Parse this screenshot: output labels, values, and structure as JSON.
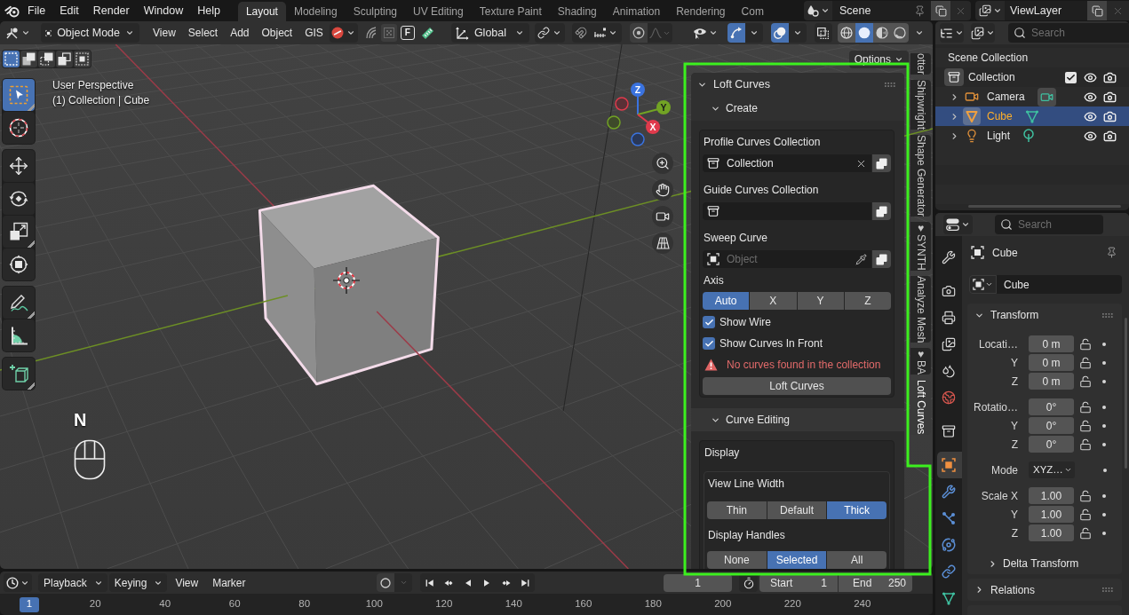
{
  "top_bar": {
    "menus": [
      "File",
      "Edit",
      "Render",
      "Window",
      "Help"
    ],
    "workspaces": [
      {
        "label": "Layout",
        "selected": true
      },
      {
        "label": "Modeling",
        "selected": false
      },
      {
        "label": "Sculpting",
        "selected": false
      },
      {
        "label": "UV Editing",
        "selected": false
      },
      {
        "label": "Texture Paint",
        "selected": false
      },
      {
        "label": "Shading",
        "selected": false
      },
      {
        "label": "Animation",
        "selected": false
      },
      {
        "label": "Rendering",
        "selected": false
      },
      {
        "label": "Com",
        "selected": false
      }
    ],
    "scene": "Scene",
    "view_layer": "ViewLayer"
  },
  "viewport_header": {
    "mode": "Object Mode",
    "menus": [
      "View",
      "Select",
      "Add",
      "Object",
      "GIS"
    ],
    "toggle_key": "F",
    "orientation": "Global",
    "gizmos_on": true,
    "overlays_on": true,
    "shading_modes": [
      {
        "kind": "wireframe",
        "selected": false
      },
      {
        "kind": "solid",
        "selected": true
      },
      {
        "kind": "material",
        "selected": false
      },
      {
        "kind": "rendered",
        "selected": false
      }
    ]
  },
  "viewport": {
    "selection_modes": [
      {
        "kind": "new",
        "selected": true
      },
      {
        "kind": "extend",
        "selected": false
      },
      {
        "kind": "subtract",
        "selected": false
      },
      {
        "kind": "invert",
        "selected": false
      },
      {
        "kind": "intersect",
        "selected": false
      }
    ],
    "tool_groups": [
      {
        "tools": [
          {
            "kind": "select_box",
            "selected": true,
            "submenu": true
          },
          {
            "kind": "cursor",
            "selected": false,
            "submenu": false
          }
        ]
      },
      {
        "tools": [
          {
            "kind": "move",
            "selected": false,
            "submenu": false
          },
          {
            "kind": "rotate",
            "selected": false,
            "submenu": false
          },
          {
            "kind": "scale",
            "selected": false,
            "submenu": true
          },
          {
            "kind": "transform",
            "selected": false,
            "submenu": false
          }
        ]
      },
      {
        "tools": [
          {
            "kind": "annotate",
            "selected": false,
            "submenu": true
          },
          {
            "kind": "measure",
            "selected": false,
            "submenu": false
          }
        ]
      },
      {
        "tools": [
          {
            "kind": "add_cube",
            "selected": false,
            "submenu": true
          }
        ]
      }
    ],
    "view_name": "User Perspective",
    "context": "(1) Collection | Cube",
    "gizmo_labels": {
      "x": "X",
      "y": "Y",
      "z": "Z"
    },
    "options": "Options",
    "key_pressed": "N"
  },
  "sidebar": {
    "panel": {
      "title": "Loft Curves",
      "expanded": true
    },
    "create": {
      "title": "Create",
      "expanded": true,
      "fields": [
        {
          "label": "Profile Curves Collection",
          "kind": "collection",
          "value": "Collection"
        },
        {
          "label": "Guide Curves Collection",
          "kind": "collection"
        },
        {
          "label": "Sweep Curve",
          "kind": "object",
          "placeholder": "Object"
        }
      ],
      "axis_label": "Axis",
      "axis_options": [
        {
          "label": "Auto",
          "selected": true
        },
        {
          "label": "X",
          "selected": false
        },
        {
          "label": "Y",
          "selected": false
        },
        {
          "label": "Z",
          "selected": false
        }
      ],
      "checkboxes": [
        {
          "label": "Show Wire",
          "checked": true
        },
        {
          "label": "Show Curves In Front",
          "checked": true
        }
      ],
      "warning": "No curves found in the collection",
      "action": "Loft Curves"
    },
    "curve_editing": {
      "title": "Curve Editing",
      "expanded": true,
      "box_title": "Display",
      "groups": [
        {
          "label": "View Line Width",
          "options": [
            {
              "label": "Thin",
              "selected": false
            },
            {
              "label": "Default",
              "selected": false
            },
            {
              "label": "Thick",
              "selected": true
            }
          ]
        },
        {
          "label": "Display Handles",
          "options": [
            {
              "label": "None",
              "selected": false
            },
            {
              "label": "Selected",
              "selected": true
            },
            {
              "label": "All",
              "selected": false
            }
          ]
        }
      ]
    },
    "tabs": [
      {
        "label": "otter",
        "selected": false
      },
      {
        "label": "Shipwright",
        "selected": false
      },
      {
        "label": "Shape Generator",
        "selected": false
      },
      {
        "label": "♥SYNTH",
        "selected": false
      },
      {
        "label": "Analyze Mesh",
        "selected": false
      },
      {
        "label": "♥BA",
        "selected": false
      },
      {
        "label": "Loft Curves",
        "selected": true
      }
    ]
  },
  "outliner": {
    "search_placeholder": "Search",
    "root": "Scene Collection",
    "items": [
      {
        "label": "Collection",
        "active": true,
        "checked": true,
        "children": [
          {
            "label": "Camera",
            "kind": "camera",
            "selected": false,
            "expanded": false,
            "data_active": true
          },
          {
            "label": "Cube",
            "kind": "mesh",
            "selected": true,
            "expanded": false,
            "data_active": false
          },
          {
            "label": "Light",
            "kind": "light",
            "selected": false,
            "expanded": false,
            "data_active": false
          }
        ]
      }
    ]
  },
  "properties": {
    "search_placeholder": "Search",
    "tab_groups": [
      {
        "tabs": [
          {
            "kind": "tool",
            "selected": false
          }
        ]
      },
      {
        "tabs": [
          {
            "kind": "render",
            "selected": false
          },
          {
            "kind": "output",
            "selected": false
          },
          {
            "kind": "view_layer",
            "selected": false
          },
          {
            "kind": "scene",
            "selected": false
          },
          {
            "kind": "world",
            "selected": false
          }
        ]
      },
      {
        "tabs": [
          {
            "kind": "collection",
            "selected": false
          }
        ]
      },
      {
        "tabs": [
          {
            "kind": "object",
            "selected": true
          },
          {
            "kind": "modifiers",
            "selected": false
          },
          {
            "kind": "particles",
            "selected": false
          },
          {
            "kind": "physics",
            "selected": false
          },
          {
            "kind": "constraints",
            "selected": false
          },
          {
            "kind": "data",
            "selected": false
          }
        ]
      }
    ],
    "object": "Cube",
    "name": "Cube",
    "panels": [
      {
        "title": "Transform",
        "expanded": true,
        "groups": [
          {
            "rows": [
              {
                "label": "Locati…",
                "value": "0 m",
                "kind": "number",
                "locked": false
              },
              {
                "label": "Y",
                "value": "0 m",
                "kind": "number",
                "locked": false
              },
              {
                "label": "Z",
                "value": "0 m",
                "kind": "number",
                "locked": false
              }
            ]
          },
          {
            "rows": [
              {
                "label": "Rotatio…",
                "value": "0°",
                "kind": "number",
                "locked": false
              },
              {
                "label": "Y",
                "value": "0°",
                "kind": "number",
                "locked": false
              },
              {
                "label": "Z",
                "value": "0°",
                "kind": "number",
                "locked": false
              }
            ]
          },
          {
            "rows": [
              {
                "label": "Mode",
                "value": "XYZ…",
                "kind": "dropdown"
              }
            ]
          },
          {
            "rows": [
              {
                "label": "Scale X",
                "value": "1.00",
                "kind": "number",
                "locked": false
              },
              {
                "label": "Y",
                "value": "1.00",
                "kind": "number",
                "locked": false
              },
              {
                "label": "Z",
                "value": "1.00",
                "kind": "number",
                "locked": false
              }
            ]
          }
        ],
        "subpanels": [
          {
            "title": "Delta Transform",
            "expanded": false
          }
        ]
      },
      {
        "title": "Relations",
        "expanded": false
      }
    ]
  },
  "timeline": {
    "menus": [
      {
        "label": "Playback",
        "kind": "dropdown"
      },
      {
        "label": "Keying",
        "kind": "dropdown"
      },
      {
        "label": "View",
        "kind": "menu"
      },
      {
        "label": "Marker",
        "kind": "menu"
      }
    ],
    "current_frame": "1",
    "start_label": "Start",
    "start": "1",
    "end_label": "End",
    "end": "250",
    "playhead": "1",
    "ruler": [
      "20",
      "40",
      "60",
      "80",
      "100",
      "120",
      "140",
      "160",
      "180",
      "200",
      "220",
      "240"
    ]
  }
}
